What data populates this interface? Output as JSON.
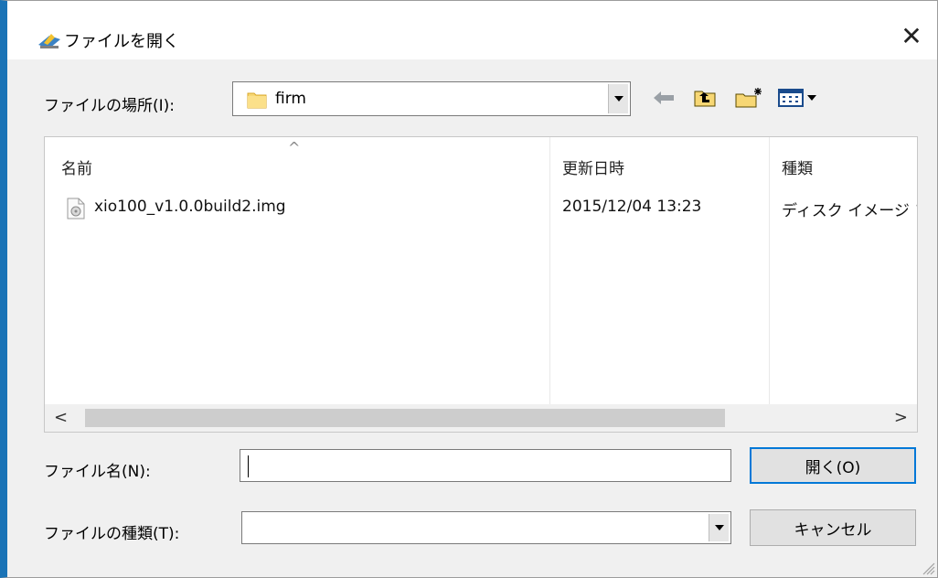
{
  "dialog": {
    "title": "ファイルを開く",
    "close_glyph": "✕"
  },
  "lookin": {
    "label": "ファイルの場所(I):",
    "value": "firm"
  },
  "list": {
    "sort_glyph": "^",
    "columns": [
      "名前",
      "更新日時",
      "種類"
    ],
    "rows": [
      {
        "name": "xio100_v1.0.0build2.img",
        "modified": "2015/12/04 13:23",
        "type": "ディスク イメージ フ"
      }
    ],
    "scroll_left": "<",
    "scroll_right": ">"
  },
  "filename": {
    "label": "ファイル名(N):",
    "value": ""
  },
  "filetype": {
    "label": "ファイルの種類(T):",
    "value": ""
  },
  "buttons": {
    "open": "開く(O)",
    "cancel": "キャンセル"
  },
  "icons": {
    "app": "app-icon",
    "folder": "folder-icon",
    "back": "back-arrow-icon",
    "up": "up-folder-icon",
    "new_folder": "new-folder-icon",
    "view": "view-menu-icon",
    "file": "disk-image-file-icon"
  },
  "colors": {
    "window_border": "#1a73b6",
    "default_button_border": "#0078d7"
  }
}
